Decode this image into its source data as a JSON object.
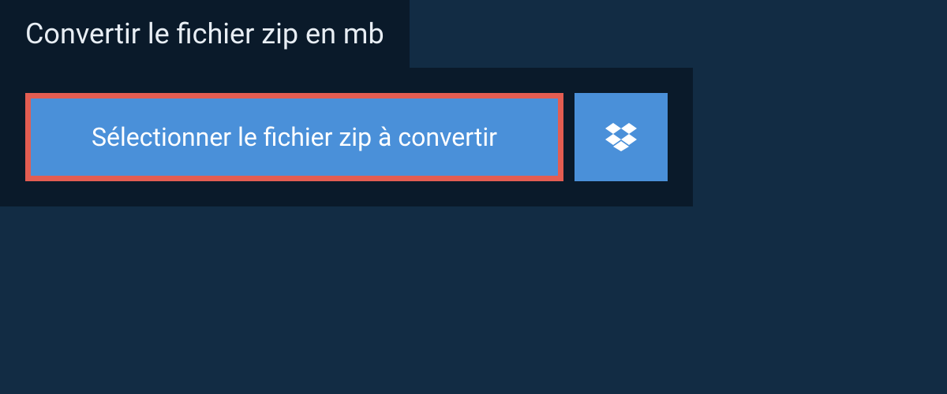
{
  "header": {
    "title": "Convertir le fichier zip en mb"
  },
  "actions": {
    "select_file_label": "Sélectionner le fichier zip à convertir",
    "dropbox_icon_name": "dropbox"
  },
  "colors": {
    "background": "#122c44",
    "panel": "#0a1a2a",
    "button_primary": "#4a90d9",
    "button_highlight_border": "#e35d52",
    "text_light": "#ffffff"
  }
}
